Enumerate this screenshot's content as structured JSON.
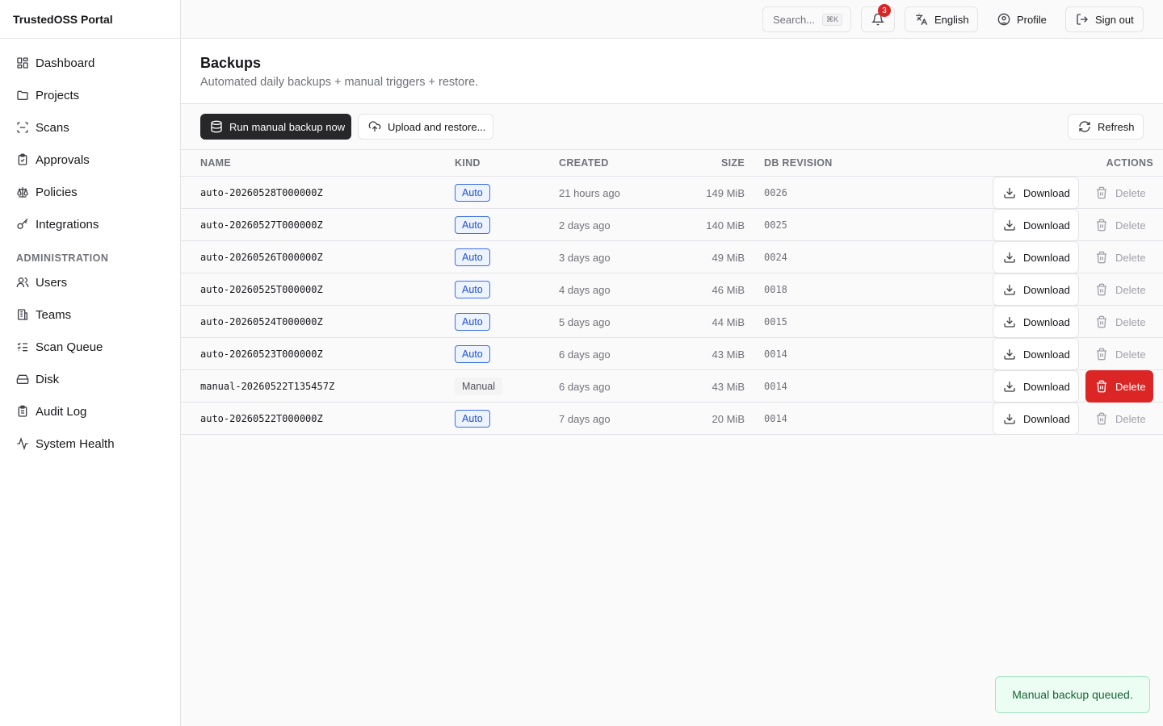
{
  "app": {
    "title": "TrustedOSS Portal"
  },
  "sidebar": {
    "items": [
      {
        "label": "Dashboard",
        "icon": "dashboard-icon"
      },
      {
        "label": "Projects",
        "icon": "folder-icon"
      },
      {
        "label": "Scans",
        "icon": "scan-icon"
      },
      {
        "label": "Approvals",
        "icon": "clipboard-check-icon"
      },
      {
        "label": "Policies",
        "icon": "scale-icon"
      },
      {
        "label": "Integrations",
        "icon": "key-icon"
      }
    ],
    "admin_section": "ADMINISTRATION",
    "admin_items": [
      {
        "label": "Users",
        "icon": "users-icon"
      },
      {
        "label": "Teams",
        "icon": "building-icon"
      },
      {
        "label": "Scan Queue",
        "icon": "list-checks-icon"
      },
      {
        "label": "Disk",
        "icon": "hard-drive-icon"
      },
      {
        "label": "Audit Log",
        "icon": "clipboard-list-icon"
      },
      {
        "label": "System Health",
        "icon": "activity-icon"
      }
    ]
  },
  "topbar": {
    "search_placeholder": "Search...",
    "search_shortcut": "⌘K",
    "notifications_count": "3",
    "language": "English",
    "profile": "Profile",
    "sign_out": "Sign out"
  },
  "page": {
    "title": "Backups",
    "subtitle": "Automated daily backups + manual triggers + restore."
  },
  "toolbar": {
    "run_backup": "Run manual backup now",
    "upload_restore": "Upload and restore...",
    "refresh": "Refresh"
  },
  "table": {
    "headers": {
      "name": "NAME",
      "kind": "KIND",
      "created": "CREATED",
      "size": "SIZE",
      "db_revision": "DB REVISION",
      "actions": "ACTIONS"
    },
    "download_label": "Download",
    "delete_label": "Delete",
    "rows": [
      {
        "name": "auto-20260528T000000Z",
        "kind": "Auto",
        "created": "21 hours ago",
        "size": "149 MiB",
        "rev": "0026"
      },
      {
        "name": "auto-20260527T000000Z",
        "kind": "Auto",
        "created": "2 days ago",
        "size": "140 MiB",
        "rev": "0025"
      },
      {
        "name": "auto-20260526T000000Z",
        "kind": "Auto",
        "created": "3 days ago",
        "size": "49 MiB",
        "rev": "0024"
      },
      {
        "name": "auto-20260525T000000Z",
        "kind": "Auto",
        "created": "4 days ago",
        "size": "46 MiB",
        "rev": "0018"
      },
      {
        "name": "auto-20260524T000000Z",
        "kind": "Auto",
        "created": "5 days ago",
        "size": "44 MiB",
        "rev": "0015"
      },
      {
        "name": "auto-20260523T000000Z",
        "kind": "Auto",
        "created": "6 days ago",
        "size": "43 MiB",
        "rev": "0014"
      },
      {
        "name": "manual-20260522T135457Z",
        "kind": "Manual",
        "created": "6 days ago",
        "size": "43 MiB",
        "rev": "0014"
      },
      {
        "name": "auto-20260522T000000Z",
        "kind": "Auto",
        "created": "7 days ago",
        "size": "20 MiB",
        "rev": "0014"
      }
    ]
  },
  "toast": {
    "message": "Manual backup queued."
  },
  "colors": {
    "primary_dark": "#27272a",
    "danger": "#dc2626",
    "auto_badge": "#1d4ed8",
    "toast_bg": "#ecfdf3"
  }
}
